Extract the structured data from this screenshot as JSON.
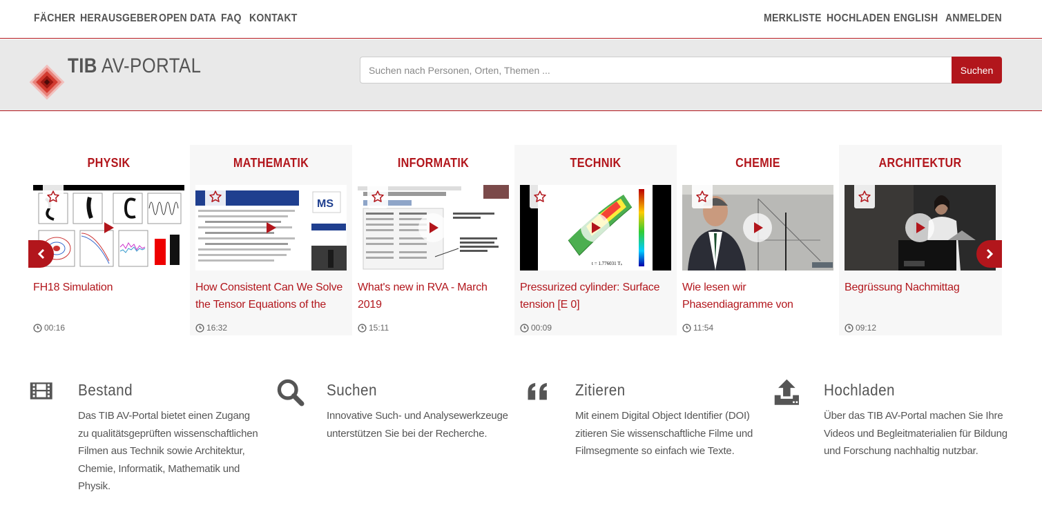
{
  "topnav": {
    "left": [
      "Fächer",
      "Herausgeber",
      "Open Data",
      "FAQ",
      "Kontakt"
    ],
    "right": [
      "Merkliste",
      "Hochladen",
      "English",
      "Anmelden"
    ]
  },
  "header": {
    "logo_bold": "TIB",
    "logo_rest": "AV-PORTAL",
    "search_placeholder": "Suchen nach Personen, Orten, Themen ...",
    "search_button": "Suchen"
  },
  "carousel": {
    "cards": [
      {
        "category": "Physik",
        "title": "FH18 Simulation",
        "duration": "00:16"
      },
      {
        "category": "Mathematik",
        "title": "How Consistent Can We Solve the Tensor Equations of the Dynamic",
        "duration": "16:32"
      },
      {
        "category": "Informatik",
        "title": "What's new in RVA - March 2019",
        "duration": "15:11"
      },
      {
        "category": "Technik",
        "title": "Pressurized cylinder: Surface tension [E 0]",
        "duration": "00:09"
      },
      {
        "category": "Chemie",
        "title": "Wie lesen wir Phasendiagramme von Mehrkomponentensystemen?",
        "duration": "11:54"
      },
      {
        "category": "Architektur",
        "title": "Begrüssung Nachmittag",
        "duration": "09:12"
      }
    ]
  },
  "features": [
    {
      "icon": "film-icon",
      "title": "Bestand",
      "text": "Das TIB AV-Portal bietet einen Zugang zu qualitätsgeprüften wissenschaftlichen Filmen aus Technik sowie Architektur, Chemie, Informatik, Mathematik und Physik."
    },
    {
      "icon": "search-icon",
      "title": "Suchen",
      "text": "Innovative Such- und Analysewerkzeuge unterstützen Sie bei der Recherche."
    },
    {
      "icon": "quote-icon",
      "title": "Zitieren",
      "text": "Mit einem Digital Object Identifier (DOI) zitieren Sie wissenschaftliche Filme und Filmsegmente so einfach wie Texte."
    },
    {
      "icon": "upload-icon",
      "title": "Hochladen",
      "text": "Über das TIB AV-Portal machen Sie Ihre Videos und Begleitmaterialien für Bildung und Forschung nachhaltig nutzbar."
    }
  ],
  "colors": {
    "accent": "#b2161c",
    "text": "#555555",
    "header_bg": "#e9e9e9"
  }
}
